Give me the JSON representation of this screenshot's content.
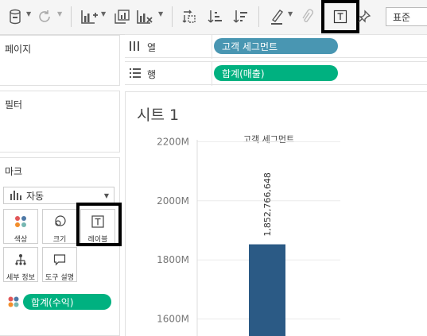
{
  "toolbar": {
    "format_select_value": "표준",
    "icons": [
      "save-datasource-icon",
      "refresh-icon",
      "new-worksheet-icon",
      "duplicate-sheet-icon",
      "clear-sheet-icon",
      "swap-rows-columns-icon",
      "sort-ascending-icon",
      "sort-descending-icon",
      "highlight-pen-icon",
      "attach-clip-icon",
      "show-mark-labels-icon",
      "pin-icon"
    ]
  },
  "panels": {
    "pages": "페이지",
    "filters": "필터",
    "marks": "마크"
  },
  "marks": {
    "type_value": "자동",
    "buttons": {
      "color": "색상",
      "size": "크기",
      "label": "레이블",
      "detail": "세부 정보",
      "tooltip": "도구 설명"
    },
    "field_pill": "합계(수익)",
    "field_pill_color": "#00b180"
  },
  "shelves": {
    "columns_label": "열",
    "rows_label": "행",
    "columns_pill": "고객 세그먼트",
    "columns_pill_color": "#4996b2",
    "rows_pill": "합계(매출)",
    "rows_pill_color": "#00b180"
  },
  "sheet": {
    "title": "시트 1"
  },
  "chart_data": {
    "type": "bar",
    "title": "",
    "column_header": "고객 세그먼트",
    "categories": [
      ""
    ],
    "values": [
      1852766648
    ],
    "data_labels": [
      "1,852,766,648"
    ],
    "ylim": [
      1540000000,
      2260000000
    ],
    "yticks": [
      1600000000,
      1800000000,
      2000000000,
      2200000000
    ],
    "ytick_labels": [
      "1600M",
      "1800M",
      "2000M",
      "2200M"
    ],
    "bar_color": "#2b5a85",
    "grid": true
  }
}
